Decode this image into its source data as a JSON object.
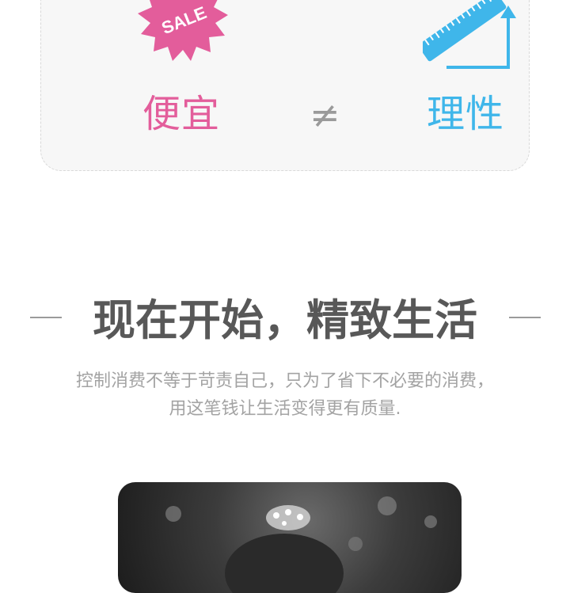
{
  "comparison": {
    "sale_badge_text": "SALE",
    "cheap_label": "便宜",
    "not_equal_symbol": "≠",
    "rational_label": "理性",
    "colors": {
      "cheap": "#e35d9b",
      "rational": "#3fb6ea",
      "symbol": "#9a9a9a"
    }
  },
  "section": {
    "headline": "现在开始，精致生活",
    "description_line1": "控制消费不等于苛责自己，只为了省下不必要的消费，",
    "description_line2": "用这笔钱让生活变得更有质量."
  },
  "photo": {
    "icon": "portrait-photo"
  }
}
